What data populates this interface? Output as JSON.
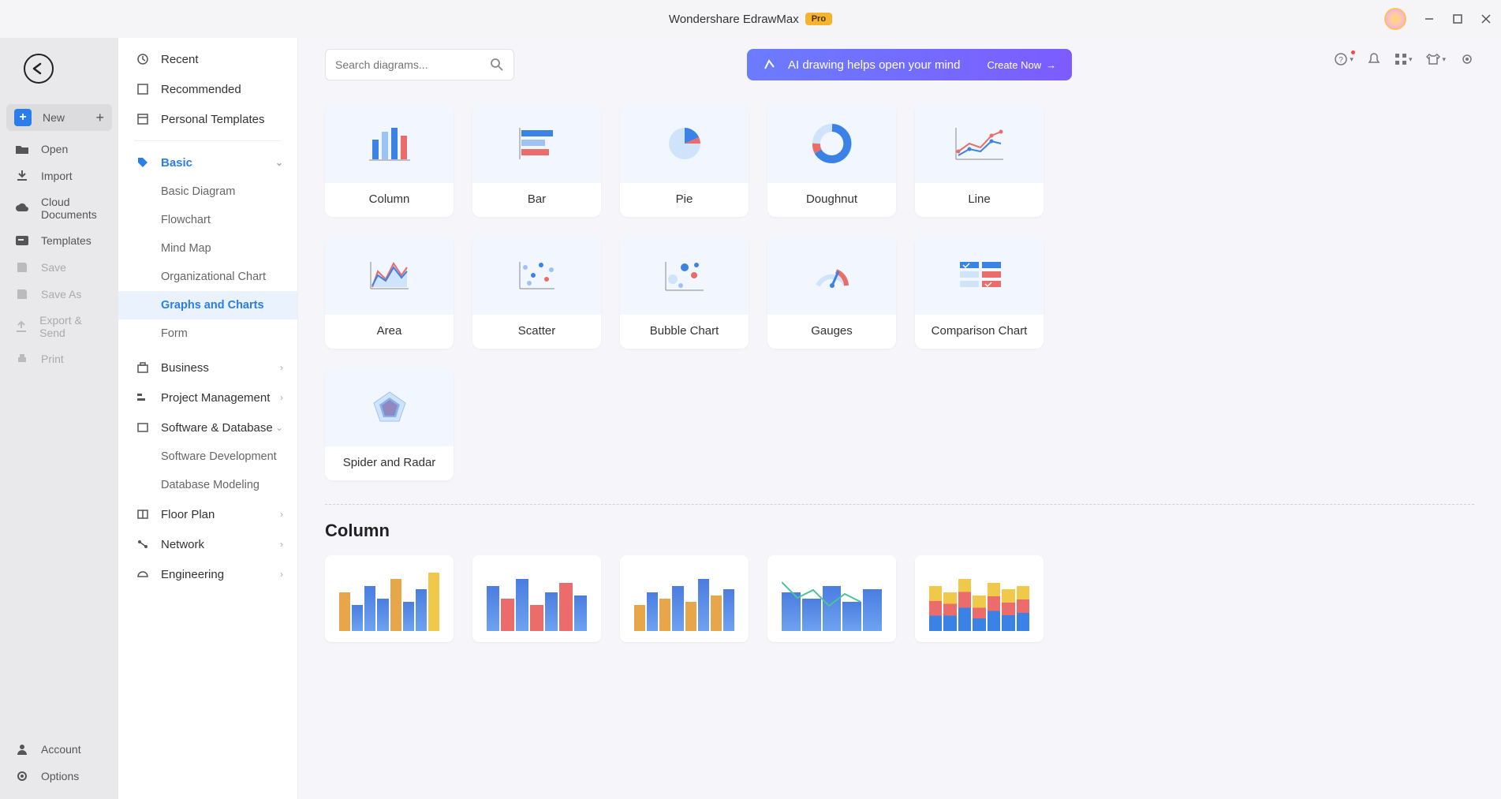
{
  "app": {
    "title": "Wondershare EdrawMax",
    "badge": "Pro"
  },
  "narrow": {
    "items": [
      {
        "id": "new",
        "label": "New",
        "active": true
      },
      {
        "id": "open",
        "label": "Open"
      },
      {
        "id": "import",
        "label": "Import"
      },
      {
        "id": "cloud",
        "label": "Cloud Documents"
      },
      {
        "id": "templates",
        "label": "Templates"
      },
      {
        "id": "save",
        "label": "Save",
        "disabled": true
      },
      {
        "id": "saveas",
        "label": "Save As",
        "disabled": true
      },
      {
        "id": "export",
        "label": "Export & Send",
        "disabled": true
      },
      {
        "id": "print",
        "label": "Print",
        "disabled": true
      }
    ],
    "footer": [
      {
        "id": "account",
        "label": "Account"
      },
      {
        "id": "options",
        "label": "Options"
      }
    ]
  },
  "categories": {
    "top": [
      "Recent",
      "Recommended",
      "Personal Templates"
    ],
    "basic": {
      "label": "Basic",
      "expanded": true,
      "subs": [
        "Basic Diagram",
        "Flowchart",
        "Mind Map",
        "Organizational Chart",
        "Graphs and Charts",
        "Form"
      ],
      "active": "Graphs and Charts"
    },
    "rest": [
      {
        "label": "Business",
        "chev": true
      },
      {
        "label": "Project Management",
        "chev": true
      },
      {
        "label": "Software & Database",
        "chev": true,
        "expanded": true,
        "subs": [
          "Software Development",
          "Database Modeling"
        ]
      },
      {
        "label": "Floor Plan",
        "chev": true
      },
      {
        "label": "Network",
        "chev": true
      },
      {
        "label": "Engineering",
        "chev": true
      }
    ]
  },
  "search": {
    "placeholder": "Search diagrams..."
  },
  "banner": {
    "text": "AI drawing helps open your mind",
    "action": "Create Now"
  },
  "chart_types": [
    "Column",
    "Bar",
    "Pie",
    "Doughnut",
    "Line",
    "Area",
    "Scatter",
    "Bubble Chart",
    "Gauges",
    "Comparison Chart",
    "Spider and Radar"
  ],
  "section": {
    "title": "Column"
  }
}
